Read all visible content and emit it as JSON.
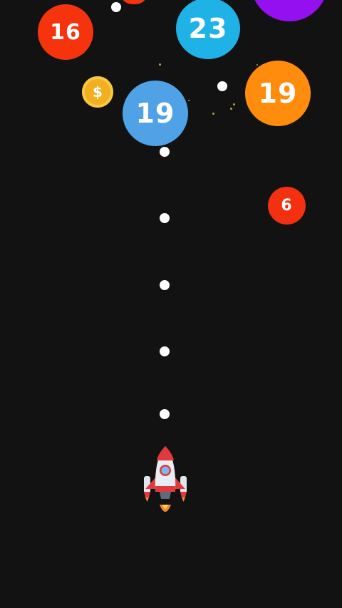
{
  "balls": [
    {
      "id": "ball-16",
      "value": "16",
      "color": "#f5340e"
    },
    {
      "id": "ball-23",
      "value": "23",
      "color": "#1fb2e6"
    },
    {
      "id": "ball-19-blue",
      "value": "19",
      "color": "#4fa2e6"
    },
    {
      "id": "ball-19-orange",
      "value": "19",
      "color": "#ff8c0d"
    },
    {
      "id": "ball-6",
      "value": "6",
      "color": "#f3300f"
    },
    {
      "id": "ball-purple-partial",
      "value": "",
      "color": "#9410f0"
    },
    {
      "id": "ball-red-partial",
      "value": "",
      "color": "#f5340e"
    }
  ],
  "coin": {
    "symbol": "$",
    "color": "#f2b01e"
  },
  "player": {
    "icon": "rocket-icon"
  },
  "colors": {
    "background": "#121212",
    "bullet": "#ffffff"
  }
}
